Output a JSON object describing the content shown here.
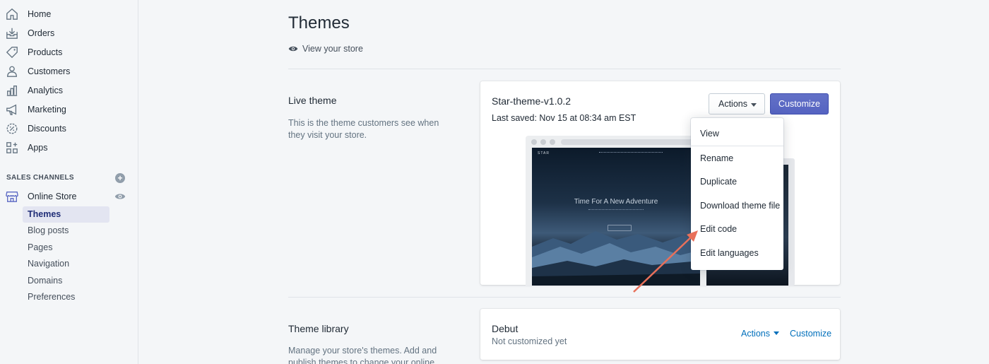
{
  "sidebar": {
    "items": [
      {
        "label": "Home",
        "icon": "home-icon"
      },
      {
        "label": "Orders",
        "icon": "orders-icon"
      },
      {
        "label": "Products",
        "icon": "tag-icon"
      },
      {
        "label": "Customers",
        "icon": "person-icon"
      },
      {
        "label": "Analytics",
        "icon": "bar-chart-icon"
      },
      {
        "label": "Marketing",
        "icon": "megaphone-icon"
      },
      {
        "label": "Discounts",
        "icon": "discount-icon"
      },
      {
        "label": "Apps",
        "icon": "apps-icon"
      }
    ],
    "sales_channels_title": "SALES CHANNELS",
    "online_store": "Online Store",
    "sub_items": [
      "Themes",
      "Blog posts",
      "Pages",
      "Navigation",
      "Domains",
      "Preferences"
    ],
    "active_sub": "Themes"
  },
  "main": {
    "title": "Themes",
    "view_store": "View your store",
    "live": {
      "heading": "Live theme",
      "description": "This is the theme customers see when they visit your store.",
      "theme_name": "Star-theme-v1.0.2",
      "last_saved": "Last saved: Nov 15 at 08:34 am EST",
      "actions_label": "Actions",
      "customize_label": "Customize",
      "preview_logo": "STAR",
      "preview_hero": "Time For A New Adventure"
    },
    "dropdown": [
      "View",
      "Rename",
      "Duplicate",
      "Download theme file",
      "Edit code",
      "Edit languages"
    ],
    "library": {
      "heading": "Theme library",
      "description": "Manage your store's themes. Add and publish themes to change your online store's",
      "theme_name": "Debut",
      "status": "Not customized yet",
      "actions_label": "Actions",
      "customize_label": "Customize"
    }
  },
  "colors": {
    "accent": "#5c6ac4",
    "link": "#006fbb",
    "annotation_arrow": "#e8705a"
  }
}
